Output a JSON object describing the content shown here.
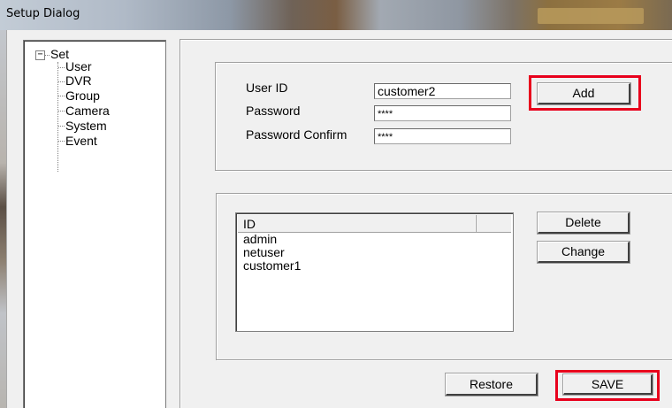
{
  "window": {
    "title": "Setup Dialog"
  },
  "tree": {
    "root": "Set",
    "expander": "−",
    "items": [
      "User",
      "DVR",
      "Group",
      "Camera",
      "System",
      "Event"
    ]
  },
  "user_form": {
    "user_id_label": "User ID",
    "user_id_value": "customer2",
    "password_label": "Password",
    "password_value": "****",
    "confirm_label": "Password Confirm",
    "confirm_value": "****",
    "add_label": "Add"
  },
  "user_list": {
    "column_header": "ID",
    "rows": [
      "admin",
      "netuser",
      "customer1"
    ],
    "delete_label": "Delete",
    "change_label": "Change"
  },
  "footer": {
    "restore_label": "Restore",
    "save_label": "SAVE"
  },
  "colors": {
    "highlight": "#e8001c",
    "dialog_bg": "#f0f0f0"
  }
}
